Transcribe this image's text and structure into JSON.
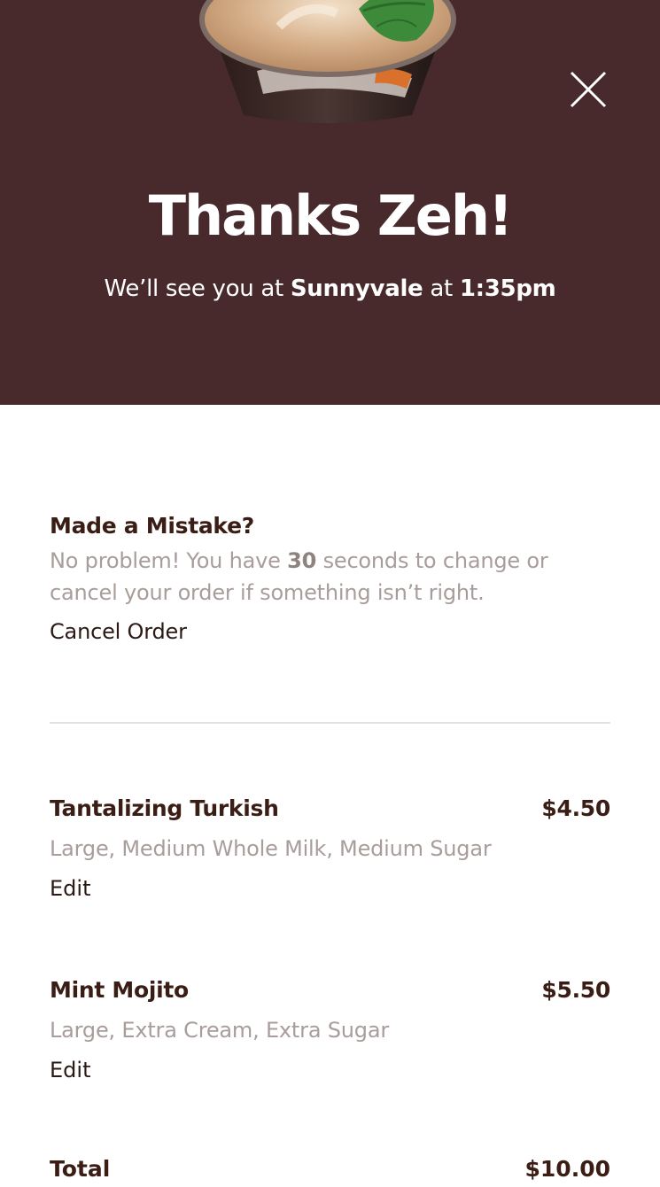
{
  "header": {
    "title": "Thanks Zeh!",
    "subtitle_prefix": "We’ll see you at ",
    "location": "Sunnyvale",
    "subtitle_mid": " at ",
    "time": "1:35pm",
    "background": "#482a2c",
    "close_icon": "close-icon"
  },
  "mistake": {
    "heading": "Made a Mistake?",
    "text_prefix": "No problem! You have ",
    "seconds": "30",
    "text_suffix": " seconds to change or cancel your order if something isn’t right.",
    "cancel_label": "Cancel Order"
  },
  "items": [
    {
      "name": "Tantalizing Turkish",
      "price": "$4.50",
      "description": "Large, Medium Whole Milk, Medium Sugar",
      "edit_label": "Edit"
    },
    {
      "name": "Mint Mojito",
      "price": "$5.50",
      "description": "Large, Extra Cream, Extra Sugar",
      "edit_label": "Edit"
    }
  ],
  "total": {
    "label": "Total",
    "value": "$10.00"
  }
}
